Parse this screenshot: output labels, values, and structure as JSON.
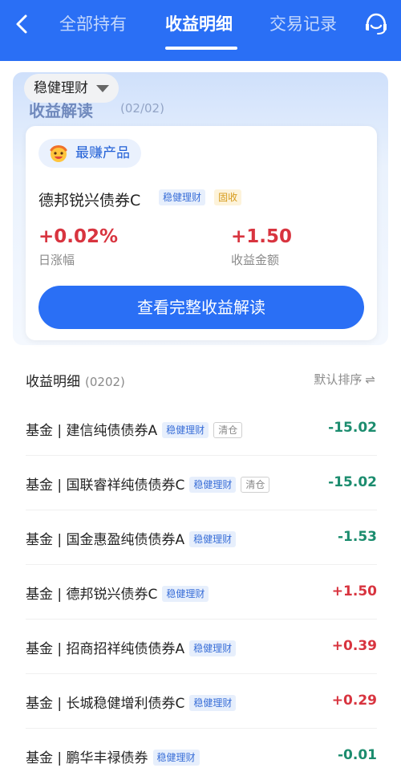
{
  "nav": {
    "tabs": [
      {
        "label": "全部持有"
      },
      {
        "label": "收益明细"
      },
      {
        "label": "交易记录"
      }
    ],
    "active_tab": "收益明细"
  },
  "filter": {
    "label": "稳健理财"
  },
  "header_behind": {
    "title": "收益解读",
    "date": "(02/02)"
  },
  "best": {
    "pill_label": "最赚产品",
    "product_name": "德邦锐兴债券C",
    "tags": [
      "稳健理财",
      "固收"
    ],
    "daily_change": "+0.02%",
    "daily_change_label": "日涨幅",
    "income": "+1.50",
    "income_label": "收益金额",
    "cta": "查看完整收益解读"
  },
  "list": {
    "title": "收益明细",
    "date": "(0202)",
    "sort_label": "默认排序",
    "sort_icon": "⇌",
    "rows": [
      {
        "name": "基金 | 建信纯债债券A",
        "tags": [
          "稳健理财",
          "清仓"
        ],
        "amount": "-15.02"
      },
      {
        "name": "基金 | 国联睿祥纯债债券C",
        "tags": [
          "稳健理财",
          "清仓"
        ],
        "amount": "-15.02"
      },
      {
        "name": "基金 | 国金惠盈纯债债券A",
        "tags": [
          "稳健理财"
        ],
        "amount": "-1.53"
      },
      {
        "name": "基金 | 德邦锐兴债券C",
        "tags": [
          "稳健理财"
        ],
        "amount": "+1.50"
      },
      {
        "name": "基金 | 招商招祥纯债债券A",
        "tags": [
          "稳健理财"
        ],
        "amount": "+0.39"
      },
      {
        "name": "基金 | 长城稳健增利债券C",
        "tags": [
          "稳健理财"
        ],
        "amount": "+0.29"
      },
      {
        "name": "基金 | 鹏华丰禄债券",
        "tags": [
          "稳健理财"
        ],
        "amount": "-0.01"
      }
    ]
  },
  "colors": {
    "primary": "#2a6ff5",
    "gain": "#d8343f",
    "loss": "#1b8c6e"
  },
  "icons": [
    "back-arrow-icon",
    "customer-service-icon",
    "dropdown-triangle-icon",
    "smiley-icon",
    "sort-swap-icon"
  ]
}
